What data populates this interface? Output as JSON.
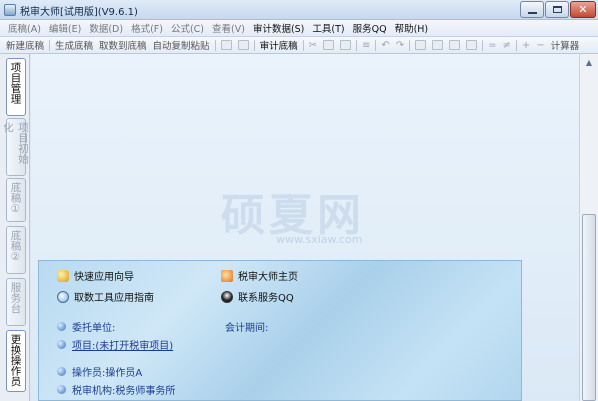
{
  "window": {
    "title": "税审大师[试用版](V9.6.1)"
  },
  "menu": [
    "底稿(A)",
    "编辑(E)",
    "数据(D)",
    "格式(F)",
    "公式(C)",
    "查看(V)",
    "审计数据(S)",
    "工具(T)",
    "服务QQ",
    "帮助(H)"
  ],
  "toolbar": {
    "new_draft": "新建底稿",
    "gen_draft": "生成底稿",
    "fetch_to_draft": "取数到底稿",
    "auto_copy_paste": "自动复制粘贴",
    "audit_draft": "审计底稿",
    "calc_label": "计算器"
  },
  "left_tabs": [
    "项目管理",
    "项目初始化",
    "底稿①",
    "底稿②",
    "服务台",
    "更换操作员"
  ],
  "watermark": {
    "text": "硕夏网",
    "url": "www.sxiaw.com"
  },
  "panel": {
    "quick_wizard": "快速应用向导",
    "homepage": "税审大师主页",
    "fetch_tool_guide": "取数工具应用指南",
    "contact_qq": "联系服务QQ",
    "client_label": "委托单位:",
    "period_label": "会计期间:",
    "project_label": "项目:",
    "project_value": "(未打开税审项目)",
    "operator_label": "操作员:",
    "operator_value": "操作员A",
    "org_label": "税审机构:",
    "org_value": "税务师事务所"
  }
}
